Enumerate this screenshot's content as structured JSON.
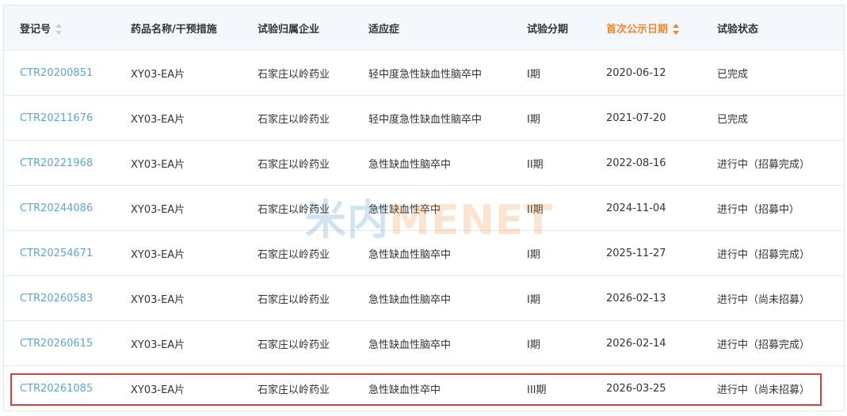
{
  "columns": [
    {
      "label": "登记号",
      "sortable": true,
      "active": false
    },
    {
      "label": "药品名称/干预措施",
      "sortable": false,
      "active": false
    },
    {
      "label": "试验归属企业",
      "sortable": false,
      "active": false
    },
    {
      "label": "适应症",
      "sortable": false,
      "active": false
    },
    {
      "label": "试验分期",
      "sortable": false,
      "active": false
    },
    {
      "label": "首次公示日期",
      "sortable": true,
      "active": true
    },
    {
      "label": "试验状态",
      "sortable": false,
      "active": false
    }
  ],
  "rows": [
    [
      "CTR20200851",
      "XY03-EA片",
      "石家庄以岭药业",
      "轻中度急性缺血性脑卒中",
      "I期",
      "2020-06-12",
      "已完成"
    ],
    [
      "CTR20211676",
      "XY03-EA片",
      "石家庄以岭药业",
      "轻中度急性缺血性脑卒中",
      "I期",
      "2021-07-20",
      "已完成"
    ],
    [
      "CTR20221968",
      "XY03-EA片",
      "石家庄以岭药业",
      "急性缺血性脑卒中",
      "II期",
      "2022-08-16",
      "进行中（招募完成）"
    ],
    [
      "CTR20244086",
      "XY03-EA片",
      "石家庄以岭药业",
      "急性缺血性卒中",
      "II期",
      "2024-11-04",
      "进行中（招募中）"
    ],
    [
      "CTR20254671",
      "XY03-EA片",
      "石家庄以岭药业",
      "急性缺血性脑卒中",
      "I期",
      "2025-11-27",
      "进行中（招募完成）"
    ],
    [
      "CTR20260583",
      "XY03-EA片",
      "石家庄以岭药业",
      "急性缺血性脑卒中",
      "I期",
      "2026-02-13",
      "进行中（尚未招募）"
    ],
    [
      "CTR20260615",
      "XY03-EA片",
      "石家庄以岭药业",
      "急性缺血性脑卒中",
      "I期",
      "2026-02-14",
      "进行中（招募完成）"
    ],
    [
      "CTR20261085",
      "XY03-EA片",
      "石家庄以岭药业",
      "急性缺血性卒中",
      "III期",
      "2026-03-25",
      "进行中（尚未招募）"
    ]
  ],
  "watermark": {
    "part_a": "米内",
    "part_b": "MENET"
  },
  "colors": {
    "link": "#5fa6cf",
    "sort_active": "#f0862b",
    "highlight": "#e03a3a",
    "header_bg": "#f4f8fc"
  }
}
